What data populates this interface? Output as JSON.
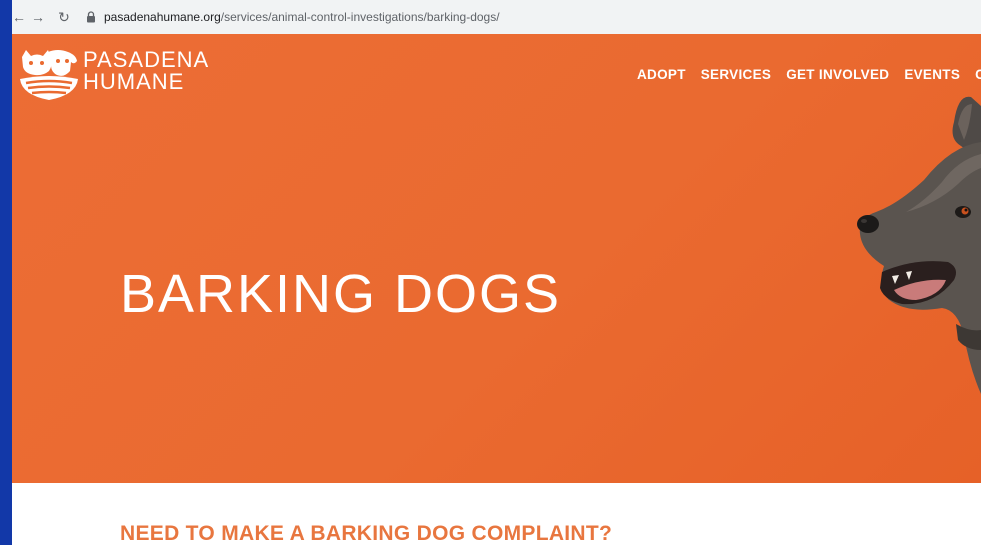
{
  "browser": {
    "url_host": "pasadenahumane.org",
    "url_path": "/services/animal-control-investigations/barking-dogs/"
  },
  "logo": {
    "line1": "PASADENA",
    "line2": "HUMANE"
  },
  "nav": [
    "ADOPT",
    "SERVICES",
    "GET INVOLVED",
    "EVENTS",
    "C"
  ],
  "hero": {
    "title": "BARKING DOGS"
  },
  "content": {
    "heading": "NEED TO MAKE A BARKING DOG COMPLAINT?"
  },
  "colors": {
    "hero_bg": "#ea6a30",
    "heading": "#e8763f",
    "outer_bg": "#1238a8"
  },
  "icons": [
    "back-arrow-icon",
    "forward-arrow-icon",
    "reload-icon",
    "lock-icon",
    "pasadena-humane-logo-icon"
  ]
}
